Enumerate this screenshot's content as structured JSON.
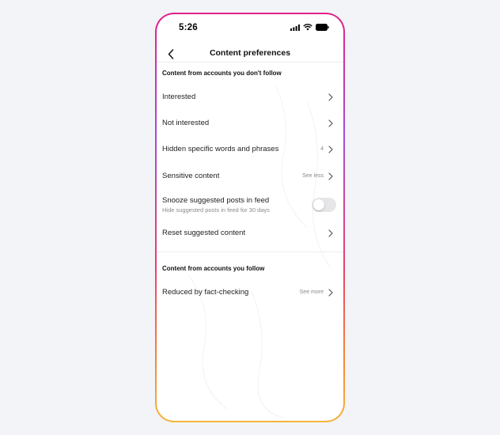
{
  "status": {
    "time": "5:26",
    "signal_icon": "cellular-signal-icon",
    "wifi_icon": "wifi-icon",
    "battery_icon": "battery-icon"
  },
  "header": {
    "back_icon": "chevron-left-icon",
    "title": "Content preferences"
  },
  "section_not_following": {
    "title": "Content from accounts you don't follow",
    "rows": [
      {
        "label": "Interested",
        "value": ""
      },
      {
        "label": "Not interested",
        "value": ""
      },
      {
        "label": "Hidden specific words and phrases",
        "value": "4"
      },
      {
        "label": "Sensitive content",
        "value": "See less"
      }
    ],
    "snooze": {
      "label": "Snooze suggested posts in feed",
      "sublabel": "Hide suggested posts in feed for 30 days",
      "enabled": false
    },
    "reset": {
      "label": "Reset suggested content"
    }
  },
  "section_following": {
    "title": "Content from accounts you follow",
    "rows": [
      {
        "label": "Reduced by fact-checking",
        "value": "See more"
      }
    ]
  },
  "colors": {
    "frame_gradient_top": "#e0218a",
    "frame_gradient_mid": "#a74ad6",
    "frame_gradient_bottom": "#f5b43a",
    "background": "#f3f4f8"
  }
}
